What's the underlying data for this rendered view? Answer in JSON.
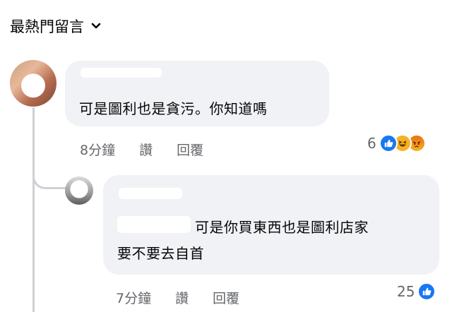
{
  "sort": {
    "label": "最熱門留言"
  },
  "comments": [
    {
      "text": "可是圖利也是貪污。你知道嗎",
      "meta": {
        "time": "8分鐘",
        "like": "讚",
        "reply": "回覆"
      },
      "reactions": {
        "count": "6",
        "types": [
          "like-icon",
          "haha-icon",
          "angry-icon"
        ]
      }
    },
    {
      "text_line1": "可是你買東西也是圖利店家",
      "text_line2": "要不要去自首",
      "meta": {
        "time": "7分鐘",
        "like": "讚",
        "reply": "回覆"
      },
      "reactions": {
        "count": "25",
        "types": [
          "like-icon"
        ]
      }
    }
  ],
  "colors": {
    "bubble": "#f0f2f5",
    "meta": "#65676b",
    "like": "#1877f2",
    "thread": "#ced0d4"
  }
}
